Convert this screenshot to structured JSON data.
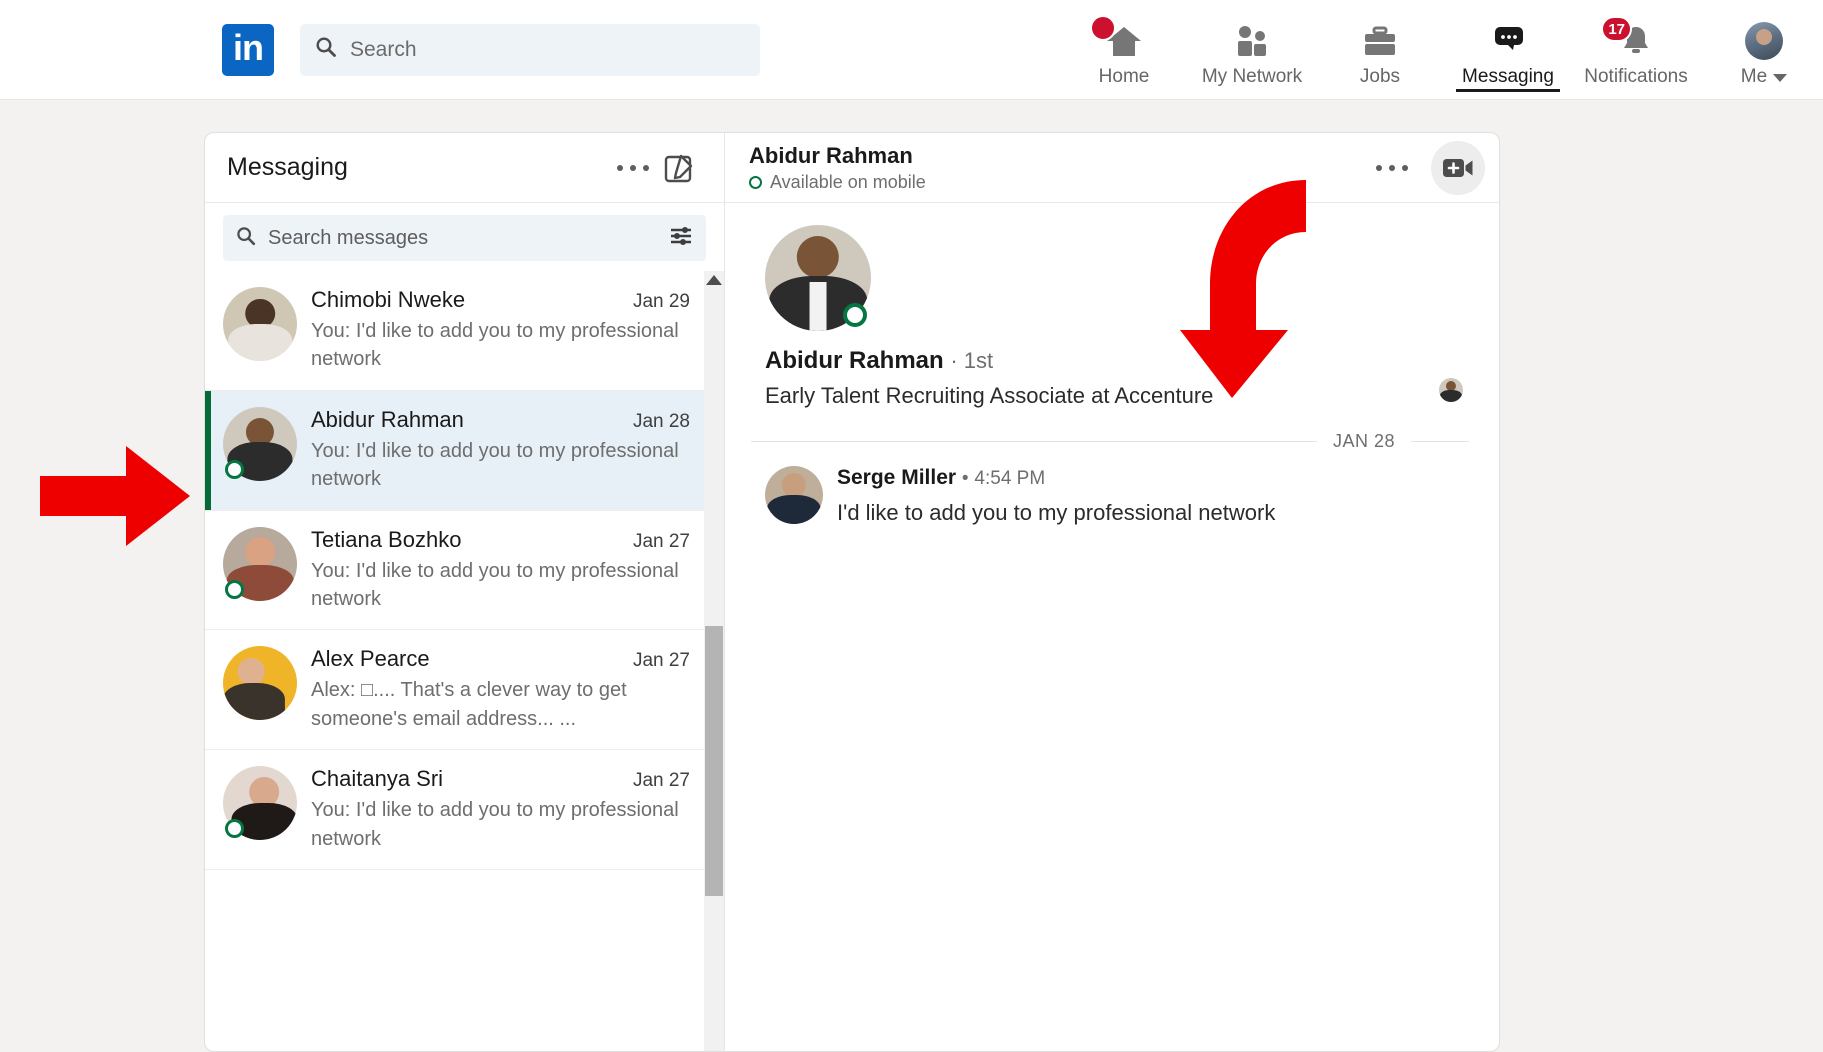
{
  "brand": {
    "logo_text": "in",
    "logo_color": "#0a66c2"
  },
  "global_search": {
    "placeholder": "Search",
    "icon": "search-icon"
  },
  "nav": {
    "items": [
      {
        "label": "Home",
        "icon": "home-icon",
        "badge": "",
        "badge_dot": true,
        "active": false
      },
      {
        "label": "My Network",
        "icon": "people-icon",
        "badge": "",
        "badge_dot": false,
        "active": false
      },
      {
        "label": "Jobs",
        "icon": "briefcase-icon",
        "badge": "",
        "badge_dot": false,
        "active": false
      },
      {
        "label": "Messaging",
        "icon": "message-bubble-icon",
        "badge": "",
        "badge_dot": false,
        "active": true
      },
      {
        "label": "Notifications",
        "icon": "bell-icon",
        "badge": "17",
        "badge_dot": false,
        "active": false
      }
    ],
    "me": {
      "label": "Me",
      "icon": "avatar",
      "caret": "chevron-down-icon"
    },
    "badge_color": "#cb112d"
  },
  "messaging": {
    "title": "Messaging",
    "overflow_icon": "more-options-icon",
    "compose_icon": "compose-message-icon",
    "search": {
      "placeholder": "Search messages",
      "icon": "search-icon",
      "filter_icon": "filter-icon"
    },
    "conversations": [
      {
        "name": "Chimobi Nweke",
        "date": "Jan 29",
        "preview": "You: I'd like to add you to my professional network",
        "selected": false,
        "presence": false,
        "avatar": {
          "skin": "#4a3426",
          "bg": "#cfc6b4",
          "shirt": "#e8e4dd"
        }
      },
      {
        "name": "Abidur Rahman",
        "date": "Jan 28",
        "preview": "You: I'd like to add you to my professional network",
        "selected": true,
        "presence": true,
        "avatar": {
          "skin": "#7a5436",
          "bg": "#cfc8bd",
          "shirt": "#2c2c2c"
        }
      },
      {
        "name": "Tetiana Bozhko",
        "date": "Jan 27",
        "preview": "You: I'd like to add you to my professional network",
        "selected": false,
        "presence": true,
        "avatar": {
          "skin": "#d9a282",
          "bg": "#b7a99b",
          "shirt": "#8e4b3a"
        }
      },
      {
        "name": "Alex Pearce",
        "date": "Jan 27",
        "preview": "Alex: □.... That's a clever way to get someone's email address... ...",
        "selected": false,
        "presence": false,
        "avatar": {
          "skin": "#e0b191",
          "bg": "#f0b429",
          "shirt": "#3a332c"
        }
      },
      {
        "name": "Chaitanya Sri",
        "date": "Jan 27",
        "preview": "You: I'd like to add you to my professional network",
        "selected": false,
        "presence": true,
        "avatar": {
          "skin": "#d8a98c",
          "bg": "#e3d8cf",
          "shirt": "#1f1a17"
        }
      }
    ],
    "selected_accent": "#046a38",
    "scrollbar": {
      "up_arrow_icon": "scroll-up-arrow-icon"
    }
  },
  "thread": {
    "header": {
      "name": "Abidur Rahman",
      "status": "Available on mobile",
      "overflow_icon": "more-options-icon",
      "video_call_icon": "video-call-add-icon"
    },
    "profile": {
      "name": "Abidur Rahman",
      "degree": "· 1st",
      "headline": "Early Talent Recruiting Associate at Accenture"
    },
    "date_divider": "JAN 28",
    "messages": [
      {
        "sender": "Serge Miller",
        "separator": "•",
        "time": "4:54 PM",
        "text": "I'd like to add you to my professional network"
      }
    ],
    "seen_indicator_icon": "seen-by-avatar"
  },
  "annotations": {
    "arrow_color": "#ee0000",
    "arrow_list_label": "arrow-pointing-to-selected-conversation",
    "arrow_video_label": "arrow-pointing-to-video-call-button"
  }
}
